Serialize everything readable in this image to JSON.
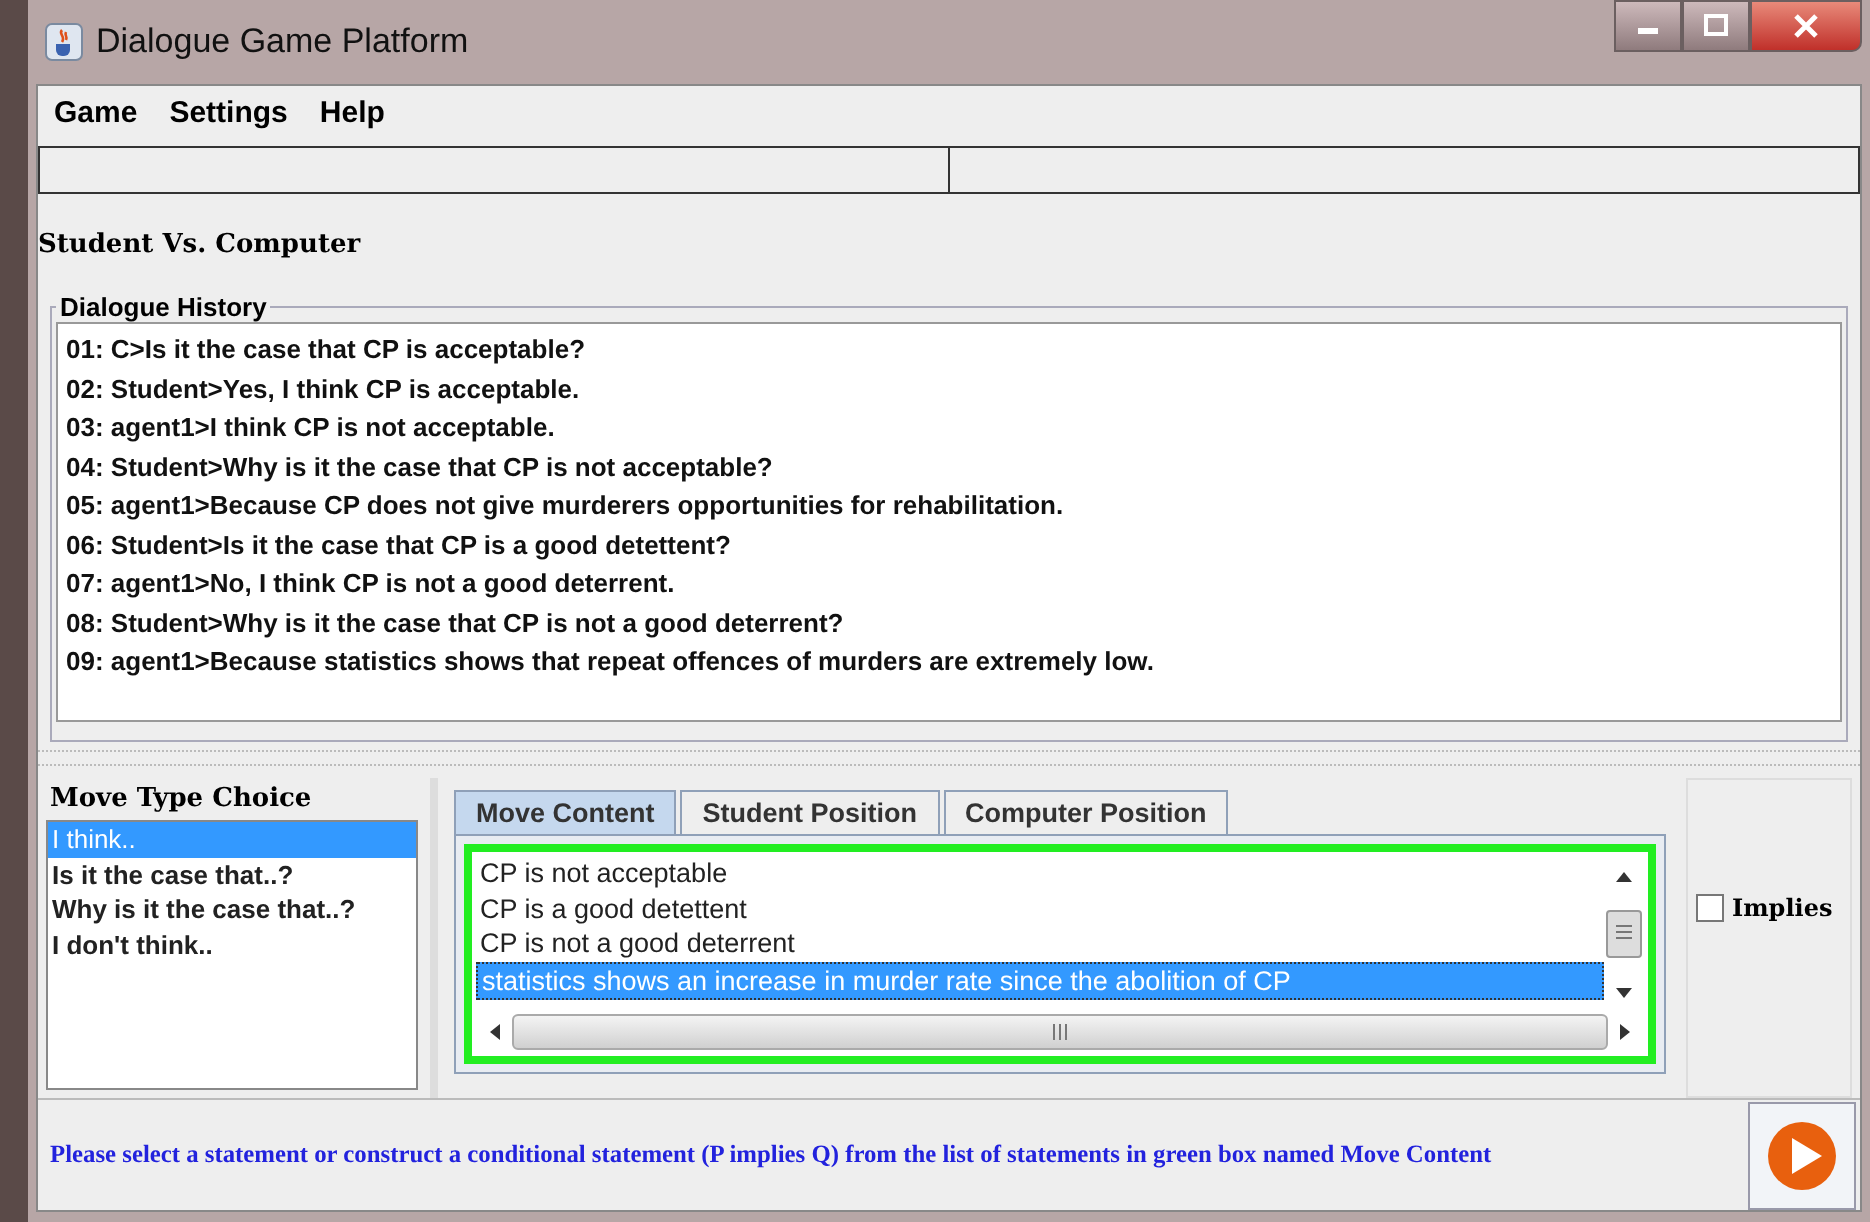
{
  "window": {
    "title": "Dialogue Game Platform"
  },
  "menu": [
    "Game",
    "Settings",
    "Help"
  ],
  "match_label": "Student  Vs. Computer",
  "history": {
    "title": "Dialogue History",
    "lines": [
      "01: C>Is it the case that CP is acceptable?",
      "02: Student>Yes, I think CP is acceptable.",
      "03: agent1>I think CP is not acceptable.",
      "04: Student>Why is it the case that CP is not acceptable?",
      "05: agent1>Because CP does not give murderers opportunities for rehabilitation.",
      "06: Student>Is it the case that CP is a good detettent?",
      "07: agent1>No, I think CP is not a good deterrent.",
      "08: Student>Why is it the case that CP is not a good deterrent?",
      "09: agent1>Because statistics shows that repeat offences of murders are extremely low."
    ]
  },
  "move_type": {
    "title": "Move Type Choice",
    "items": [
      {
        "label": "I think..",
        "selected": true
      },
      {
        "label": "Is it the case that..?",
        "selected": false
      },
      {
        "label": "Why is it the case that..?",
        "selected": false
      },
      {
        "label": "I don't think..",
        "selected": false
      }
    ]
  },
  "tabs": [
    {
      "label": "Move Content",
      "selected": true
    },
    {
      "label": "Student Position",
      "selected": false
    },
    {
      "label": "Computer Position",
      "selected": false
    }
  ],
  "statements": [
    {
      "label": "CP is not acceptable",
      "selected": false
    },
    {
      "label": "CP is a good detettent",
      "selected": false
    },
    {
      "label": "CP is not a good deterrent",
      "selected": false
    },
    {
      "label": "statistics shows an increase in murder rate since the abolition of CP",
      "selected": true
    }
  ],
  "implies": {
    "label": "Implies",
    "checked": false
  },
  "status": "Please select a statement or construct a conditional statement (P implies Q) from the list of statements in green box named Move Content"
}
